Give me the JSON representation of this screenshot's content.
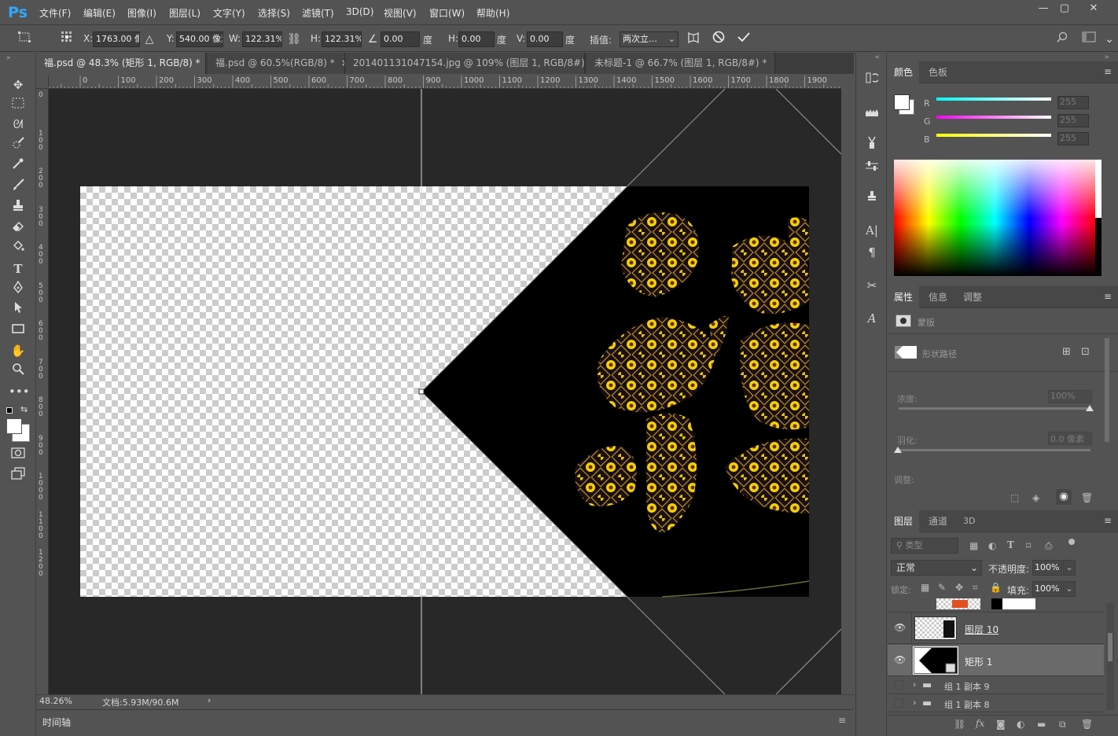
{
  "app": {
    "logo": "Ps"
  },
  "menu": [
    "文件(F)",
    "编辑(E)",
    "图像(I)",
    "图层(L)",
    "文字(Y)",
    "选择(S)",
    "滤镜(T)",
    "3D(D)",
    "视图(V)",
    "窗口(W)",
    "帮助(H)"
  ],
  "window_controls": {
    "minimize": "—",
    "maximize": "▢",
    "close": "✕"
  },
  "options": {
    "x_label": "X:",
    "x_value": "1763.00 像",
    "y_label": "Y:",
    "y_value": "540.00 像素",
    "w_label": "W:",
    "w_value": "122.31%",
    "h_label": "H:",
    "h_value": "122.31%",
    "angle_value": "0.00",
    "angle_unit": "度",
    "hskew_label": "H:",
    "hskew_value": "0.00",
    "hskew_unit": "度",
    "vskew_label": "V:",
    "vskew_value": "0.00",
    "vskew_unit": "度",
    "interp_label": "插值:",
    "interp_value": "两次立…"
  },
  "tabs": [
    {
      "label": "福.psd @ 48.3% (矩形 1, RGB/8) *",
      "close": "×"
    },
    {
      "label": "福.psd @ 60.5%(RGB/8) *",
      "close": "×"
    },
    {
      "label": "201401131047154.jpg @ 109% (图层 1, RGB/8#) *",
      "close": "×"
    },
    {
      "label": "未标题-1 @ 66.7% (图层 1, RGB/8#) *",
      "close": "×"
    }
  ],
  "ruler_h": [
    "0",
    "100",
    "200",
    "300",
    "400",
    "500",
    "600",
    "700",
    "800",
    "900",
    "1000",
    "1100",
    "1200",
    "1300",
    "1400",
    "1500",
    "1600",
    "1700",
    "1800",
    "1900"
  ],
  "ruler_v": [
    "0",
    "1\n0\n0",
    "2\n0\n0",
    "3\n0\n0",
    "4\n0\n0",
    "5\n0\n0",
    "6\n0\n0",
    "7\n0\n0",
    "8\n0\n0",
    "9\n0\n0",
    "1\n0\n0\n0",
    "1\n1\n0\n0",
    "1\n2\n0\n0"
  ],
  "status": {
    "zoom": "48.26%",
    "doc": "文档:5.93M/90.6M",
    "arrow": "›"
  },
  "timeline": {
    "label": "时间轴"
  },
  "color_panel": {
    "tabs": [
      "颜色",
      "色板"
    ],
    "channels": [
      {
        "name": "R",
        "value": "255"
      },
      {
        "name": "G",
        "value": "255"
      },
      {
        "name": "B",
        "value": "255"
      }
    ]
  },
  "properties_panel": {
    "tabs": [
      "属性",
      "信息",
      "调整"
    ],
    "mask_label": "蒙版",
    "path_label": "形状路径",
    "density_label": "浓度:",
    "density_value": "100%",
    "feather_label": "羽化:",
    "feather_value": "0.0 像素",
    "adjust_label": "调整:"
  },
  "layers_panel": {
    "tabs": [
      "图层",
      "通道",
      "3D"
    ],
    "filter_placeholder": "类型",
    "blend_mode": "正常",
    "opacity_label": "不透明度:",
    "opacity_value": "100%",
    "lock_label": "锁定:",
    "fill_label": "填充:",
    "fill_value": "100%",
    "layers": [
      {
        "name": "图层 10",
        "visible": true
      },
      {
        "name": "矩形 1",
        "visible": true
      },
      {
        "name": "组 1 副本 9",
        "visible": false
      },
      {
        "name": "组 1 副本 8",
        "visible": false
      }
    ],
    "footer_icons": [
      "link-icon",
      "fx-icon",
      "mask-icon",
      "adjustment-icon",
      "folder-icon",
      "new-layer-icon",
      "trash-icon"
    ]
  },
  "colors": {
    "ps_blue": "#31a8ff",
    "panel_bg": "#535353",
    "canvas_bg": "#282828",
    "gold": "#f2d200"
  }
}
